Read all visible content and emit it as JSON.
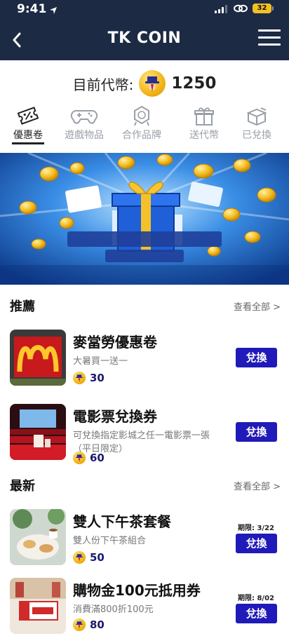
{
  "status": {
    "time": "9:41",
    "battery": "32"
  },
  "header": {
    "title": "TK COIN"
  },
  "balance": {
    "label": "目前代幣:",
    "value": "1250"
  },
  "tabs": [
    {
      "label": "優惠卷",
      "icon": "ticket-icon",
      "active": true
    },
    {
      "label": "遊戲物品",
      "icon": "gamepad-icon",
      "active": false
    },
    {
      "label": "合作品牌",
      "icon": "brand-badge-icon",
      "active": false
    },
    {
      "label": "送代幣",
      "icon": "gift-icon",
      "active": false
    },
    {
      "label": "已兌換",
      "icon": "box-icon",
      "active": false
    }
  ],
  "banner": {
    "image": "gift-box-coins-illustration"
  },
  "recommended": {
    "title": "推薦",
    "see_all": "查看全部 >",
    "items": [
      {
        "name": "麥當勞優惠卷",
        "desc": "大暑買一送一",
        "price": "30",
        "button": "兌換",
        "thumb": "mcdonalds-sign-photo"
      },
      {
        "name": "電影票兌換券",
        "desc": "可兌換指定影城之任一電影票一張（平日限定）",
        "price": "60",
        "button": "兌換",
        "thumb": "cinema-hall-photo"
      }
    ]
  },
  "latest": {
    "title": "最新",
    "see_all": "查看全部 >",
    "items": [
      {
        "name": "雙人下午茶套餐",
        "desc": "雙人份下午茶組合",
        "price": "50",
        "button": "兌換",
        "expiry": "期限: 3/22",
        "thumb": "afternoon-tea-photo"
      },
      {
        "name": "購物金100元抵用券",
        "desc": "消費滿800折100元",
        "price": "80",
        "button": "兌換",
        "expiry": "期限: 8/02",
        "thumb": "shopping-voucher-photo"
      }
    ]
  },
  "colors": {
    "header_bg": "#1c2a44",
    "button_bg": "#1f1ab8",
    "coin": "#f2b417",
    "price_text": "#1a1a6e"
  }
}
